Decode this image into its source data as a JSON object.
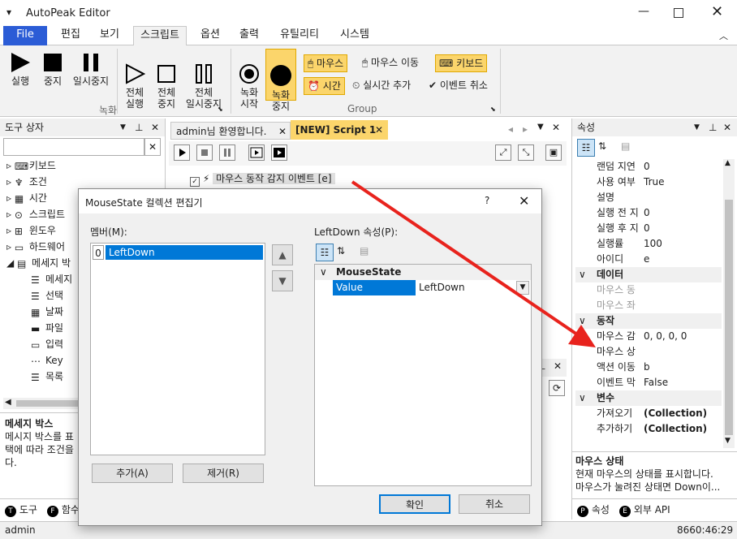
{
  "app": {
    "title": "AutoPeak Editor"
  },
  "ribbon_tabs": [
    "File",
    "편집",
    "보기",
    "스크립트",
    "옵션",
    "출력",
    "유틸리티",
    "시스템"
  ],
  "ribbon": {
    "record_group": {
      "label": "녹화",
      "buttons": [
        "실행",
        "중지",
        "일시중지",
        "전체\n실행",
        "전체\n중지",
        "전체\n일시중지"
      ]
    },
    "group2": {
      "label": "Group",
      "record_start": "녹화\n시작",
      "record_stop": "녹화\n중지",
      "mouse": "마우스",
      "mouse_move": "마우스 이동",
      "keyboard": "키보드",
      "time": "시간",
      "realtime_add": "실시간 추가",
      "event_cancel": "이벤트 취소"
    }
  },
  "toolbox": {
    "title": "도구 상자",
    "items": [
      "키보드",
      "조건",
      "시간",
      "스크립트",
      "윈도우",
      "하드웨어",
      "메세지 박",
      "메세지",
      "선택",
      "날짜",
      "파일",
      "입력",
      "Key",
      "목록"
    ],
    "desc_title": "메세지 박스",
    "desc_text": "메시지 박스를 표\n택에 따라 조건을\n다.",
    "tabs": [
      "도구",
      "함수"
    ]
  },
  "doc_tabs": [
    "admin님 환영합니다.",
    "[NEW] Script 1"
  ],
  "script": {
    "event_label": "마우스 동작 감지 이벤트 [e]"
  },
  "properties": {
    "title": "속성",
    "rows": [
      [
        "랜덤 지연",
        "0"
      ],
      [
        "사용 여부",
        "True"
      ],
      [
        "설명",
        ""
      ],
      [
        "실행 전 지",
        "0"
      ],
      [
        "실행 후 지",
        "0"
      ],
      [
        "실행률",
        "100"
      ],
      [
        "아이디",
        "e"
      ]
    ],
    "cat_data": "데이터",
    "data_rows": [
      [
        "마우스 동",
        "",
        ""
      ],
      [
        "마우스 좌",
        "",
        ""
      ]
    ],
    "cat_action": "동작",
    "action_rows": [
      [
        "마우스 감",
        "0, 0, 0, 0"
      ],
      [
        "마우스 상",
        ""
      ],
      [
        "액션 이동",
        "b"
      ],
      [
        "이벤트 막",
        "False"
      ]
    ],
    "cat_var": "변수",
    "var_rows": [
      [
        "가져오기",
        "(Collection)"
      ],
      [
        "추가하기",
        "(Collection)"
      ]
    ],
    "desc_title": "마우스 상태",
    "desc_text": "현재 마우스의 상태를 표시합니다.\n마우스가 눌려진 상태면 Down이...",
    "tabs": [
      "속성",
      "외부 API"
    ]
  },
  "dialog": {
    "title": "MouseState 컬렉션 편집기",
    "help": "?",
    "members_label": "멤버(M):",
    "member_index": "0",
    "member_value": "LeftDown",
    "props_label": "LeftDown 속성(P):",
    "category": "MouseState",
    "prop_name": "Value",
    "prop_value": "LeftDown",
    "add": "추가(A)",
    "remove": "제거(R)",
    "ok": "확인",
    "cancel": "취소"
  },
  "status": {
    "user": "admin",
    "time": "8660:46:29"
  },
  "colors": {
    "accent": "#2b5cd6",
    "select": "#0078d7",
    "highlight": "#fbd56b",
    "arrow": "#e8231d"
  }
}
